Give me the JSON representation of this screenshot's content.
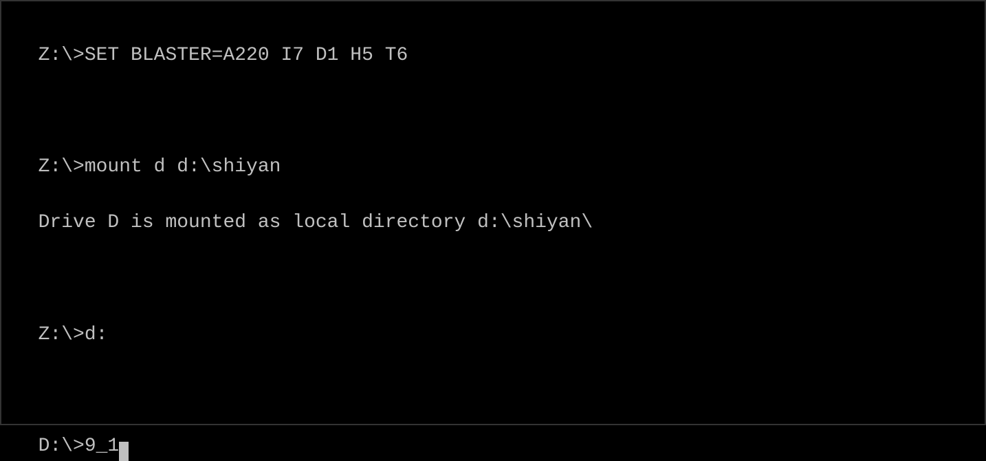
{
  "terminal": {
    "lines": [
      "Z:\\>SET BLASTER=A220 I7 D1 H5 T6",
      "",
      "Z:\\>mount d d:\\shiyan",
      "Drive D is mounted as local directory d:\\shiyan\\",
      "",
      "Z:\\>d:",
      "",
      "D:\\>9_1"
    ],
    "prompt_line": "D:\\>9_1"
  }
}
